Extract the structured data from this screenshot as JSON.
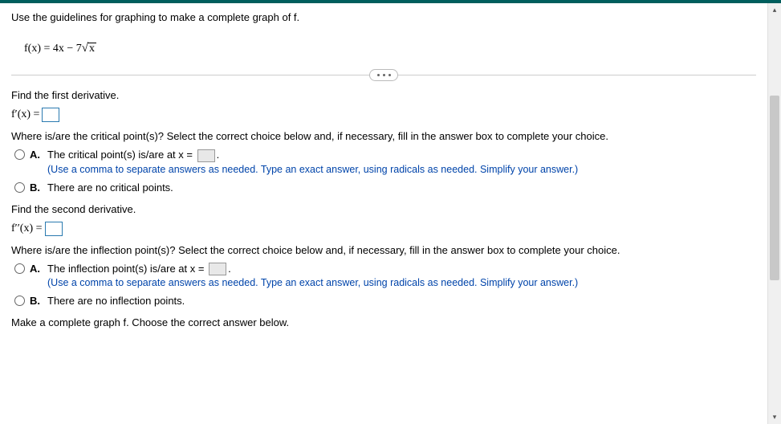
{
  "header": {
    "instruction": "Use the guidelines for graphing to make a complete graph of f.",
    "equation_lhs": "f(x) = 4x − 7",
    "equation_sqrt_arg": "x"
  },
  "first_derivative": {
    "prompt": "Find the first derivative.",
    "formula_lhs": "f′(x) =",
    "critical_prompt": "Where is/are the critical point(s)? Select the correct choice below and, if necessary, fill in the answer box to complete your choice.",
    "choice_a_label": "A.",
    "choice_a_text_pre": "The critical point(s) is/are at x =",
    "choice_a_text_post": ".",
    "choice_a_hint": "(Use a comma to separate answers as needed. Type an exact answer, using radicals as needed. Simplify your answer.)",
    "choice_b_label": "B.",
    "choice_b_text": "There are no critical points."
  },
  "second_derivative": {
    "prompt": "Find the second derivative.",
    "formula_lhs": "f′′(x) =",
    "inflection_prompt": "Where is/are the inflection point(s)? Select the correct choice below and, if necessary, fill in the answer box to complete your choice.",
    "choice_a_label": "A.",
    "choice_a_text_pre": "The inflection point(s) is/are at x =",
    "choice_a_text_post": ".",
    "choice_a_hint": "(Use a comma to separate answers as needed. Type an exact answer, using radicals as needed. Simplify your answer.)",
    "choice_b_label": "B.",
    "choice_b_text": "There are no inflection points."
  },
  "graph_prompt": "Make a complete graph f. Choose the correct answer below."
}
